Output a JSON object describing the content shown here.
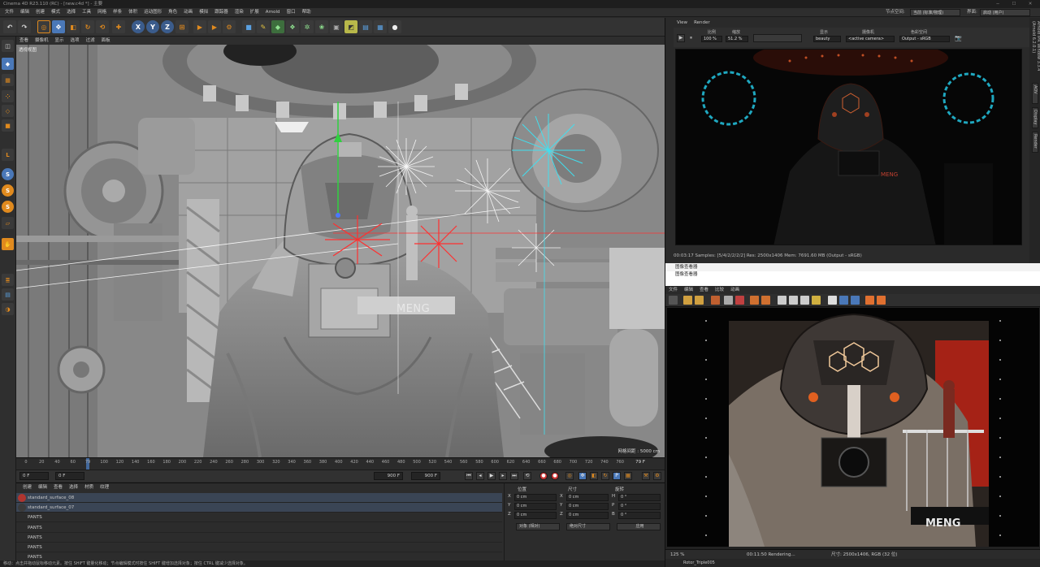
{
  "window": {
    "title": "Cinema 4D R23.110 (RC) - [new.c4d *] - 主要",
    "controls": [
      "─",
      "☐",
      "✕"
    ]
  },
  "menubar": {
    "items": [
      "文件",
      "编辑",
      "创建",
      "模式",
      "选择",
      "工具",
      "网格",
      "样条",
      "体积",
      "运动图形",
      "角色",
      "动画",
      "模拟",
      "跟踪器",
      "渲染",
      "扩展",
      "Arnold",
      "窗口",
      "帮助"
    ],
    "node_space_label": "节点空间:",
    "node_space_value": "当前 (标准/物理)",
    "layout_label": "界面:",
    "layout_value": "启动 (用户)"
  },
  "toolbar": {
    "axis_labels": [
      "X",
      "Y",
      "Z"
    ]
  },
  "viewport": {
    "menu": [
      "查看",
      "摄像机",
      "显示",
      "选项",
      "过滤",
      "面板"
    ],
    "label": "透视视图",
    "grid_info": "网格间距 : 5000 cm",
    "overlay_text": "MENG"
  },
  "timeline": {
    "ticks": [
      "0",
      "20",
      "40",
      "60",
      "79",
      "100",
      "120",
      "140",
      "160",
      "180",
      "200",
      "220",
      "240",
      "260",
      "280",
      "300",
      "320",
      "340",
      "360",
      "380",
      "400",
      "420",
      "440",
      "460",
      "480",
      "500",
      "520",
      "540",
      "560",
      "580",
      "600",
      "620",
      "640",
      "660",
      "680",
      "700",
      "720",
      "740",
      "760"
    ],
    "end_label": "79 F",
    "playhead_frame": 79,
    "max_frame": 790
  },
  "transport": {
    "start": "0 F",
    "current": "0 F",
    "end1": "900 F",
    "end2": "900 F"
  },
  "materials": {
    "menu": [
      "创建",
      "编辑",
      "查看",
      "选择",
      "材质",
      "纹理"
    ],
    "rows": [
      {
        "name": "standard_surface_08",
        "color": "#b0352f"
      },
      {
        "name": "standard_surface_07",
        "color": "#3a3a3a"
      },
      {
        "name": "PANTS",
        "color": ""
      },
      {
        "name": "PANTS",
        "color": ""
      },
      {
        "name": "PANTS",
        "color": ""
      },
      {
        "name": "PANTS",
        "color": ""
      },
      {
        "name": "PANTS",
        "color": ""
      }
    ]
  },
  "coords": {
    "headers": [
      "位置",
      "尺寸",
      "旋转"
    ],
    "rows": [
      {
        "axis": "X",
        "pos": "0 cm",
        "size_axis": "X",
        "size": "0 cm",
        "rot_axis": "H",
        "rot": "0 °"
      },
      {
        "axis": "Y",
        "pos": "0 cm",
        "size_axis": "Y",
        "size": "0 cm",
        "rot_axis": "P",
        "rot": "0 °"
      },
      {
        "axis": "Z",
        "pos": "0 cm",
        "size_axis": "Z",
        "size": "0 cm",
        "rot_axis": "B",
        "rot": "0 °"
      }
    ],
    "mode_dropdown": "对象 (相对)",
    "size_dropdown": "绝对尺寸",
    "apply": "应用"
  },
  "status": {
    "text": "移动：点击并拖动鼠标移动元素。按住 SHIFT 键量化移动；节点编辑模式时按住 SHIFT 键增加选择对象；按住 CTRL 键减少选择对象。"
  },
  "render_view": {
    "menu": [
      "View",
      "Render"
    ],
    "ratio_label": "比例",
    "ratio_value": "100 %",
    "zoom_label": "缩放",
    "zoom_value": "51.2 %",
    "display_label": "显示",
    "display_value": "beauty",
    "camera_label": "摄像机",
    "camera_value": "<active camera>",
    "colorspace_label": "色彩空间",
    "colorspace_value": "Output - sRGB",
    "status": "00:03:17  Samples: [5/4/2/2/2/2]  Res: 2500x1406  Mem: 7691.60 MB  (Output - sRGB)",
    "side_label": "Arnold IPR Window 3.3.4 (Arnold 6.2.0.1)",
    "side_tabs": [
      "AOV",
      "Display",
      "Render"
    ],
    "overlay_text": "MENG"
  },
  "picture_viewer": {
    "title": "图像查看器",
    "title2": "图像查看器",
    "menu": [
      "文件",
      "编辑",
      "查看",
      "比较",
      "动画"
    ],
    "status_zoom": "125 %",
    "status_time": "00:11:50 Rendering...",
    "status_size": "尺寸: 2500x1406, RGB (32 位)",
    "status_bottom": "Rotor_Triple005",
    "overlay_text": "MENG"
  },
  "colors": {
    "accent_blue": "#4a78b8",
    "orange": "#e08a1e",
    "viewport_bg": "#8c8c8c"
  }
}
